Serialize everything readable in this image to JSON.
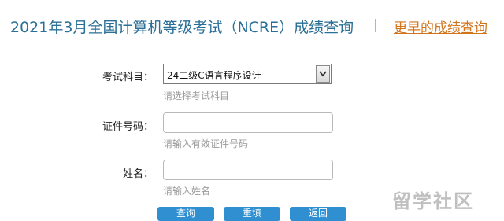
{
  "header": {
    "title": "2021年3月全国计算机等级考试（NCRE）成绩查询",
    "separator": "|",
    "earlier_link": "更早的成绩查询"
  },
  "form": {
    "subject": {
      "label": "考试科目：",
      "selected": "24二级C语言程序设计",
      "hint": "请选择考试科目"
    },
    "id_number": {
      "label": "证件号码：",
      "value": "",
      "hint": "请输入有效证件号码"
    },
    "name": {
      "label": "姓名：",
      "value": "",
      "hint": "请输入姓名"
    }
  },
  "buttons": {
    "query": "查询",
    "reset": "重填",
    "back": "返回"
  },
  "watermark": "留学社区",
  "colors": {
    "title": "#2a6f97",
    "link": "#d1741c",
    "button": "#2f8fd1"
  }
}
